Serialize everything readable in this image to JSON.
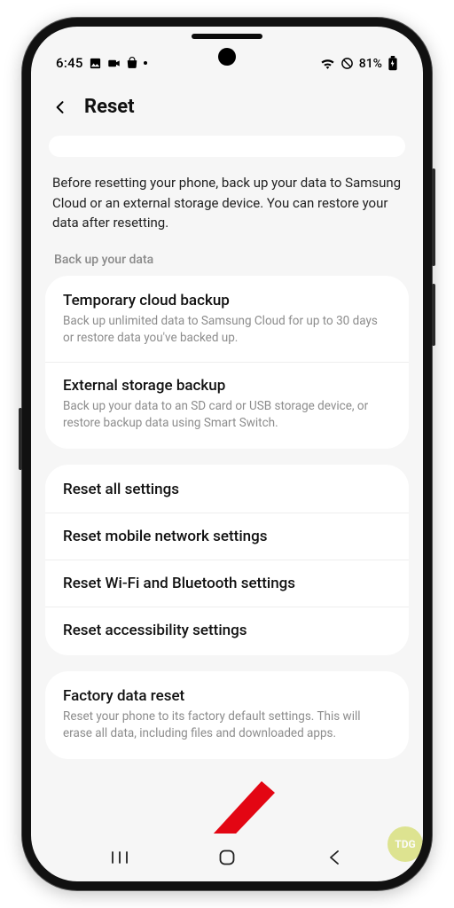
{
  "status": {
    "time": "6:45",
    "battery_text": "81%"
  },
  "header": {
    "title": "Reset"
  },
  "intro": "Before resetting your phone, back up your data to Samsung Cloud or an external storage device. You can restore your data after resetting.",
  "section_label": "Back up your data",
  "backup_items": [
    {
      "title": "Temporary cloud backup",
      "sub": "Back up unlimited data to Samsung Cloud for up to 30 days or restore data you've backed up."
    },
    {
      "title": "External storage backup",
      "sub": "Back up your data to an SD card or USB storage device, or restore backup data using Smart Switch."
    }
  ],
  "reset_items": [
    {
      "title": "Reset all settings"
    },
    {
      "title": "Reset mobile network settings"
    },
    {
      "title": "Reset Wi-Fi and Bluetooth settings"
    },
    {
      "title": "Reset accessibility settings"
    }
  ],
  "factory": {
    "title": "Factory data reset",
    "sub": "Reset your phone to its factory default settings. This will erase all data, including files and downloaded apps."
  },
  "watermark": "TDG"
}
